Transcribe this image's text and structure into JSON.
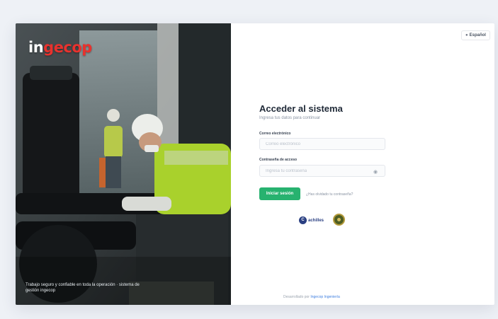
{
  "brand": {
    "logo_prefix": "in",
    "logo_accent": "gecop"
  },
  "hero": {
    "caption": "Trabajo seguro y confiable en toda la operación · sistema de gestión ingecop"
  },
  "header": {
    "language_label": "Español"
  },
  "login": {
    "title": "Acceder al sistema",
    "subtitle": "Ingresa tus datos para continuar",
    "email_label": "Correo electrónico",
    "email_placeholder": "Correo electrónico",
    "password_label": "Contraseña de acceso",
    "password_placeholder": "Ingresa tu contraseña",
    "submit_label": "Iniciar sesión",
    "forgot_label": "¿Has olvidado tu contraseña?"
  },
  "partners": {
    "first_mark": "C",
    "first_name": "achilles"
  },
  "footer": {
    "prefix": "Desarrollado por ",
    "link": "Ingecop Ingeniería"
  },
  "colors": {
    "accent": "#27b26f",
    "brand_red": "#e8322e",
    "link": "#3f7fe0"
  }
}
